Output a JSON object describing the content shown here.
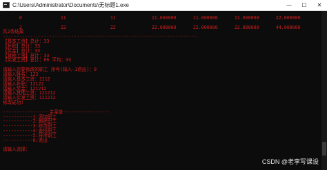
{
  "window": {
    "title": "C:\\Users\\Administrator\\Documents\\无标题1.exe",
    "minimize_glyph": "—",
    "maximize_glyph": "☐",
    "close_glyph": "✕"
  },
  "table": {
    "rows": [
      [
        "0",
        "11",
        "11",
        "11.000000",
        "11.000000",
        "11.000000",
        "22.000000"
      ],
      [
        "2",
        "22",
        "22",
        "22.000000",
        "22.000000",
        "22.000000",
        "44.000000"
      ]
    ]
  },
  "console_lines": [
    "",
    "共2条结果",
    "-----------------------------------------------------------------------",
    "【基本工资】总计：33",
    "【补贴】总计：33",
    "【奖金】总计：33",
    "【其他工资】总计：33",
    "【实发工资】总计：66 平均：33",
    "",
    "请输入您要修改的职工 序号(输入-1退出)：0",
    "请输入姓名：123",
    "请输入基本工资：1212",
    "请输入补贴：12122",
    "请输入奖金：121212",
    "请输入其他工资：121212",
    "请输入实发工资：121212",
    "修改成功!",
    "",
    "-----------------主菜单-----------------",
    "-----------1:添加职工",
    "-----------2:删除职工",
    "-----------3:修改职工",
    "-----------4:查找职工",
    "-----------5:排序职工",
    "-----------0:退出",
    "",
    "请输入选择："
  ],
  "watermark": "CSDN @老李写课设"
}
